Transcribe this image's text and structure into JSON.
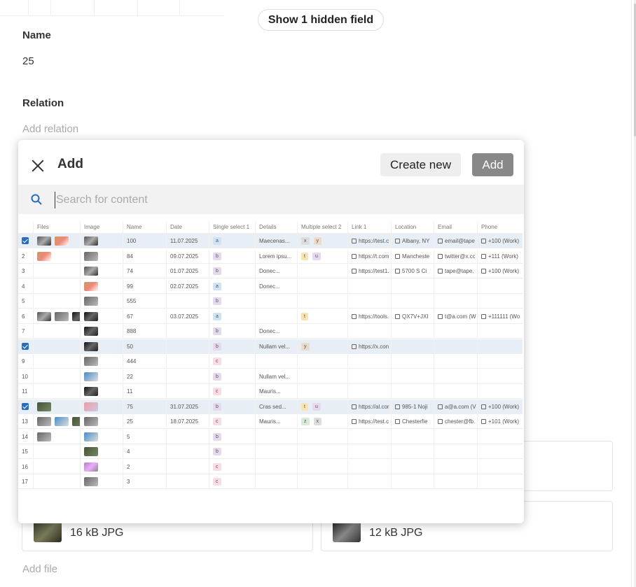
{
  "background_form": {
    "hidden_fields_button": "Show 1 hidden field",
    "name_label": "Name",
    "name_value": "25",
    "relation_label": "Relation",
    "relation_placeholder": "Add relation",
    "files": [
      {
        "size": "16 kB JPG"
      },
      {
        "size": "12 kB JPG"
      }
    ],
    "add_file": "Add file"
  },
  "modal": {
    "title": "Add",
    "create_new_label": "Create new",
    "add_label": "Add",
    "search_placeholder": "Search for content"
  },
  "grid": {
    "columns": [
      "Files",
      "Image",
      "Name",
      "Date",
      "Single select 1",
      "Details",
      "Multiple select 2",
      "Link 1",
      "Location",
      "Email",
      "Phone"
    ],
    "rows": [
      {
        "sel": true,
        "files": [
          "th1",
          "th2"
        ],
        "image": "th1",
        "name": "100",
        "date": "11.07.2025",
        "single": "a",
        "details": "Maecenas...",
        "multi": [
          "x",
          "y"
        ],
        "link": "https://test.c",
        "location": "Albany, NY",
        "email": "email@tape",
        "phone": "+100 (Work)"
      },
      {
        "id": "2",
        "files": [
          "th2"
        ],
        "image": "th3",
        "name": "84",
        "date": "09.07.2025",
        "single": "b",
        "details": "Lorem ipsu...",
        "multi": [
          "t",
          "u"
        ],
        "link": "https://t.com",
        "location": "Mancheste",
        "email": "twitter@x.cc",
        "phone": "+111 (Work)"
      },
      {
        "id": "3",
        "files": [],
        "image": "th1",
        "name": "74",
        "date": "01.07.2025",
        "single": "b",
        "details": "Donec...",
        "multi": [],
        "link": "https://test1.",
        "location": "5700 S Ci",
        "email": "tape@tape.",
        "phone": "+100 (Work)"
      },
      {
        "id": "4",
        "files": [],
        "image": "th2",
        "name": "99",
        "date": "02.07.2025",
        "single": "a",
        "details": "Donec...",
        "multi": []
      },
      {
        "id": "5",
        "files": [],
        "image": "th3",
        "name": "555",
        "date": "",
        "single": "b",
        "details": "",
        "multi": []
      },
      {
        "id": "6",
        "files": [
          "th1",
          "th3",
          "th5"
        ],
        "image": "th5",
        "name": "67",
        "date": "03.07.2025",
        "single": "a",
        "details": "",
        "multi": [
          "t"
        ],
        "link": "https://tools.",
        "location": "QX7V+JXI",
        "email": "t@a.com (W",
        "phone": "+111111 (Wo"
      },
      {
        "id": "7",
        "files": [],
        "image": "th5",
        "name": "888",
        "date": "",
        "single": "b",
        "details": "Donec...",
        "multi": []
      },
      {
        "sel": true,
        "files": [],
        "image": "th5",
        "name": "50",
        "date": "",
        "single": "b",
        "details": "Nullam vel...",
        "multi": [
          "y"
        ],
        "link": "https://x.con"
      },
      {
        "id": "9",
        "files": [],
        "image": "th3",
        "name": "444",
        "date": "",
        "single": "c",
        "details": "",
        "multi": []
      },
      {
        "id": "10",
        "files": [],
        "image": "th6",
        "name": "22",
        "date": "",
        "single": "b",
        "details": "Nullam vel...",
        "multi": []
      },
      {
        "id": "11",
        "files": [],
        "image": "th5",
        "name": "11",
        "date": "",
        "single": "c",
        "details": "Mauris...",
        "multi": []
      },
      {
        "sel": true,
        "files": [
          "th7"
        ],
        "image": "th8",
        "name": "75",
        "date": "31.07.2025",
        "single": "b",
        "details": "Cras sed...",
        "multi": [
          "t",
          "u"
        ],
        "link": "https://al.cor",
        "location": "985-1 Noji",
        "email": "a@a.com (V",
        "phone": "+100 (Work)"
      },
      {
        "id": "13",
        "files": [
          "th3",
          "th6",
          "th7"
        ],
        "image": "th3",
        "name": "25",
        "date": "18.07.2025",
        "single": "c",
        "details": "Mauris...",
        "multi": [
          "z",
          "x"
        ],
        "link": "https://test.c",
        "location": "Chesterfie",
        "email": "chester@fb.",
        "phone": "+101 (Work)"
      },
      {
        "id": "14",
        "files": [
          "th3"
        ],
        "image": "th6",
        "name": "5",
        "date": "",
        "single": "b",
        "details": "",
        "multi": []
      },
      {
        "id": "15",
        "files": [],
        "image": "th7",
        "name": "4",
        "date": "",
        "single": "b",
        "details": "",
        "multi": []
      },
      {
        "id": "16",
        "files": [],
        "image": "th4",
        "name": "2",
        "date": "",
        "single": "c",
        "details": "",
        "multi": []
      },
      {
        "id": "17",
        "files": [],
        "image": "th3",
        "name": "3",
        "date": "",
        "single": "c",
        "details": "",
        "multi": []
      }
    ]
  }
}
